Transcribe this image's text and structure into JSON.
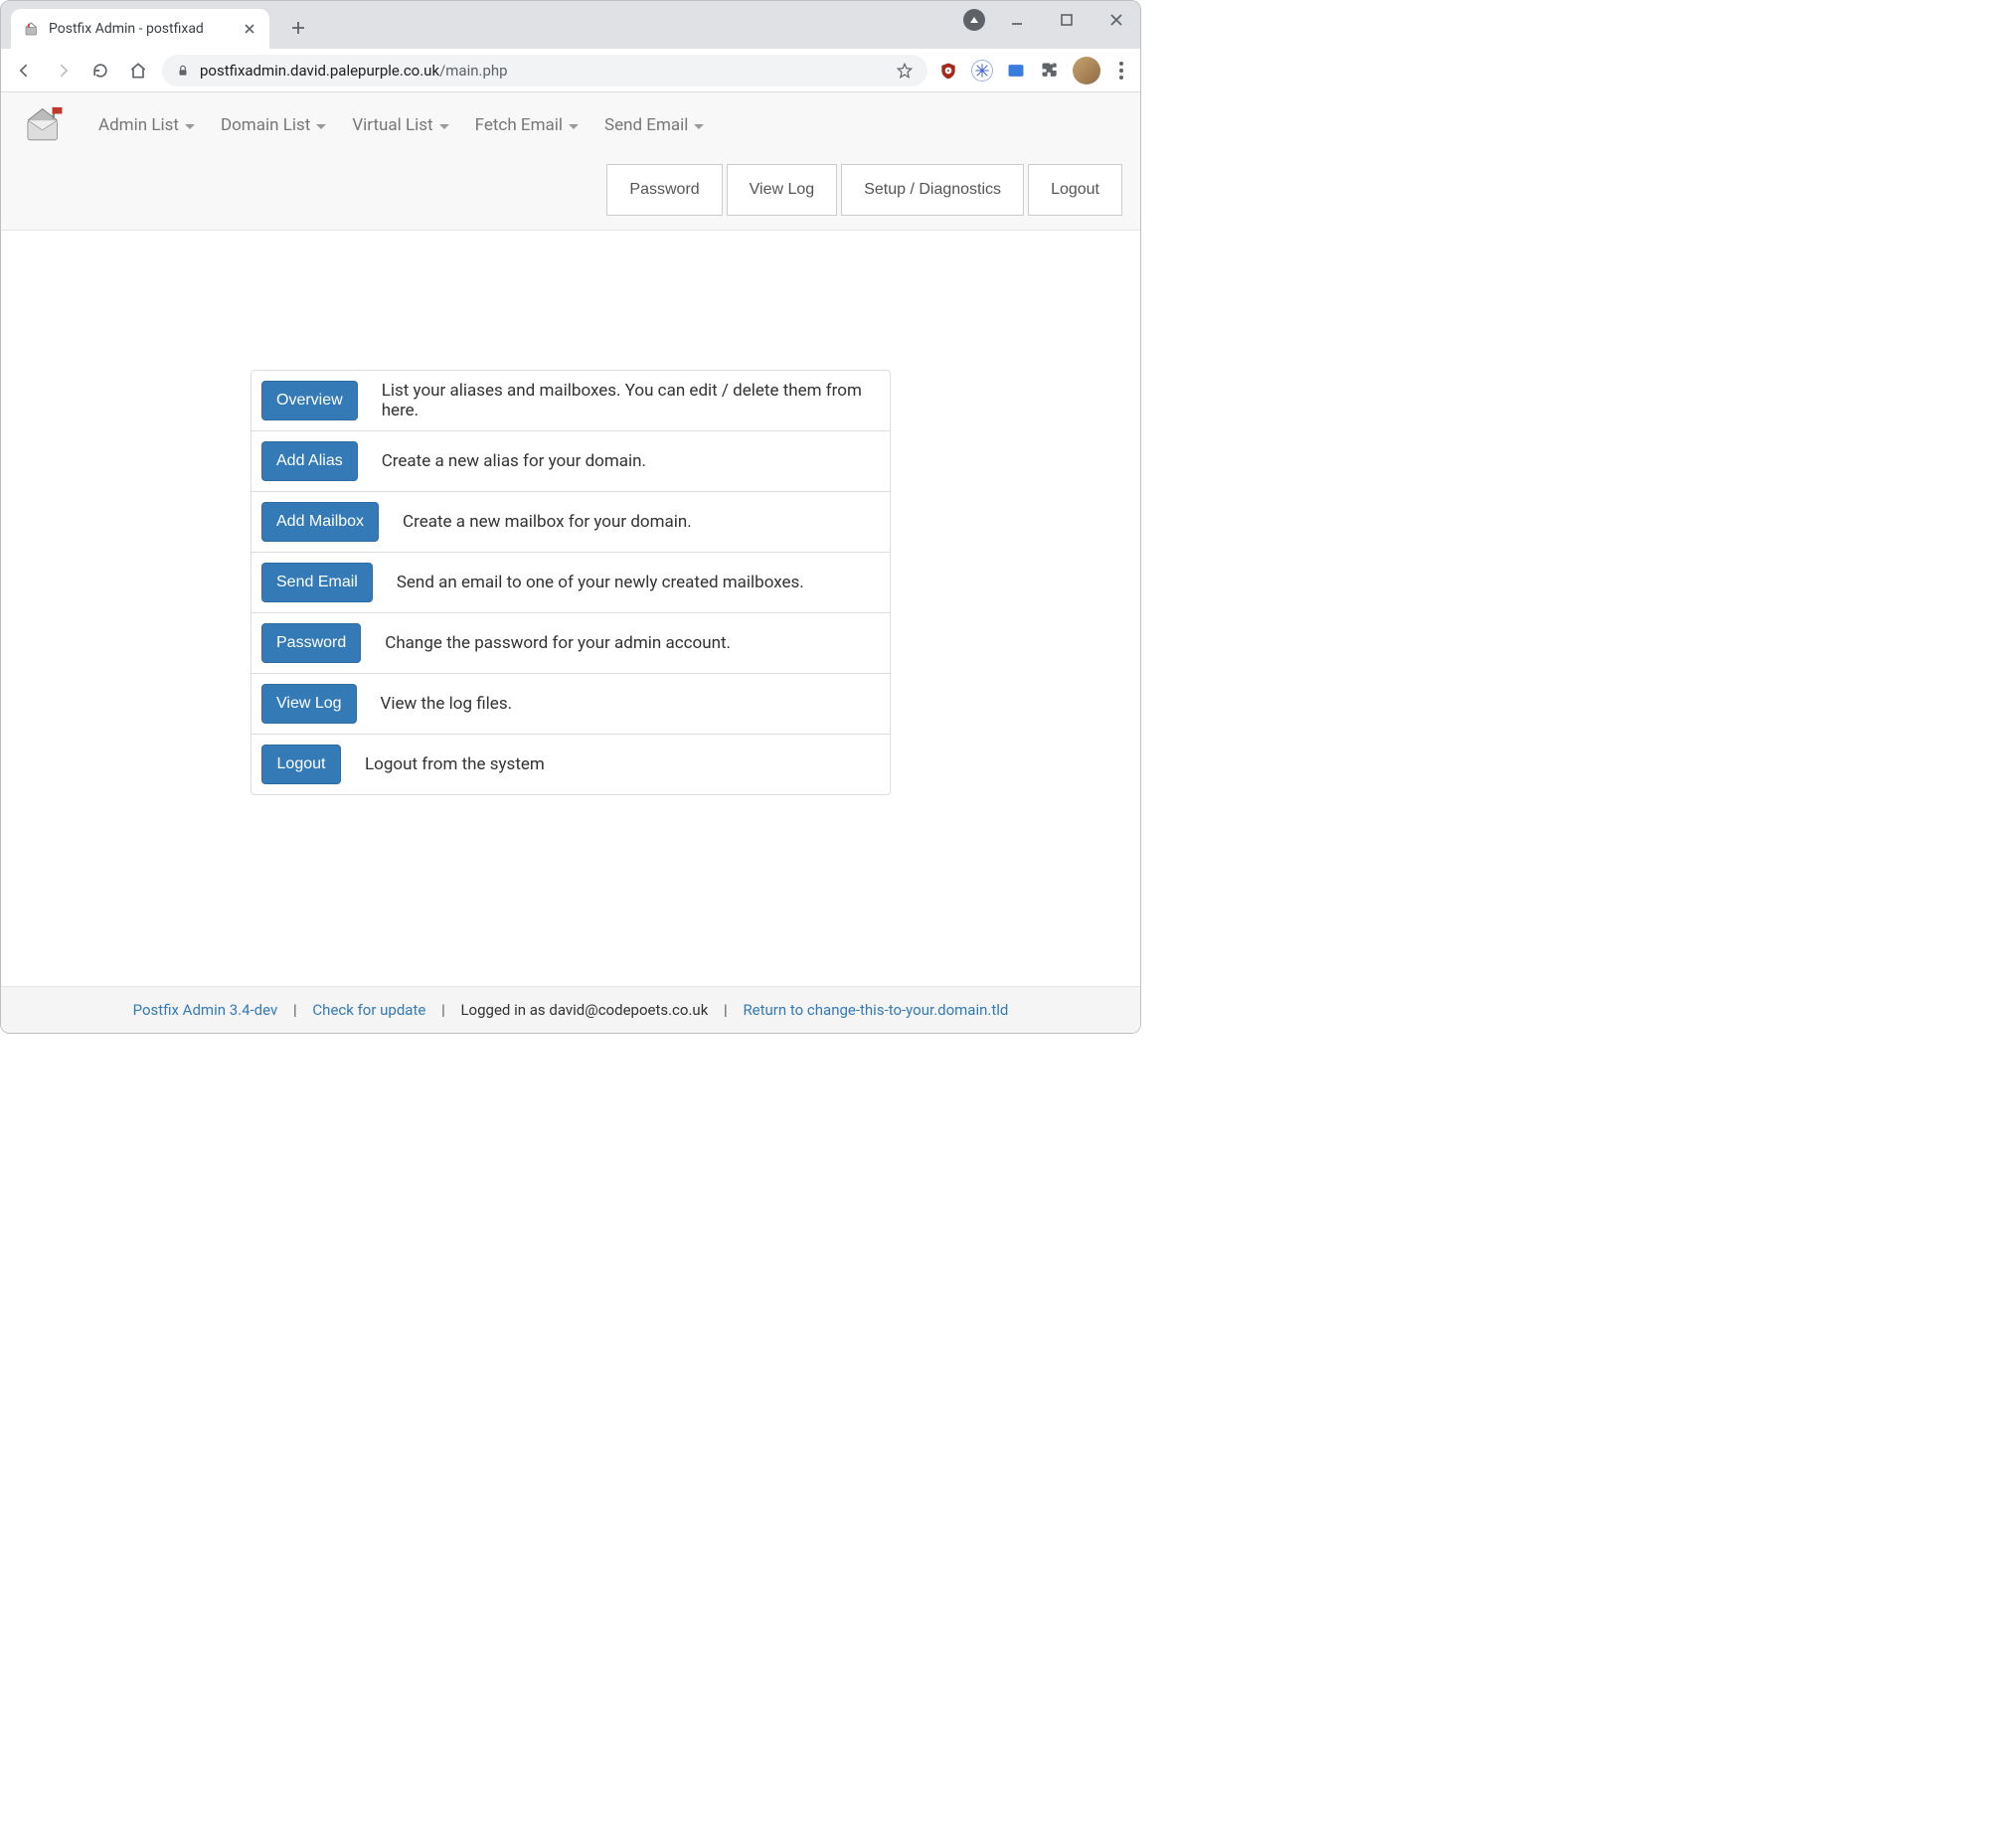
{
  "browser": {
    "tab_title": "Postfix Admin - postfixad",
    "url_host": "postfixadmin.david.palepurple.co.uk",
    "url_path": "/main.php"
  },
  "nav": {
    "items": [
      {
        "label": "Admin List"
      },
      {
        "label": "Domain List"
      },
      {
        "label": "Virtual List"
      },
      {
        "label": "Fetch Email"
      },
      {
        "label": "Send Email"
      }
    ],
    "right_buttons": [
      {
        "label": "Password"
      },
      {
        "label": "View Log"
      },
      {
        "label": "Setup / Diagnostics"
      },
      {
        "label": "Logout"
      }
    ]
  },
  "actions": [
    {
      "button": "Overview",
      "desc": "List your aliases and mailboxes. You can edit / delete them from here."
    },
    {
      "button": "Add Alias",
      "desc": "Create a new alias for your domain."
    },
    {
      "button": "Add Mailbox",
      "desc": "Create a new mailbox for your domain."
    },
    {
      "button": "Send Email",
      "desc": "Send an email to one of your newly created mailboxes."
    },
    {
      "button": "Password",
      "desc": "Change the password for your admin account."
    },
    {
      "button": "View Log",
      "desc": "View the log files."
    },
    {
      "button": "Logout",
      "desc": "Logout from the system"
    }
  ],
  "footer": {
    "version_link": "Postfix Admin 3.4-dev",
    "update_link": "Check for update",
    "login_text": "Logged in as david@codepoets.co.uk",
    "return_link": "Return to change-this-to-your.domain.tld",
    "sep": "|"
  }
}
